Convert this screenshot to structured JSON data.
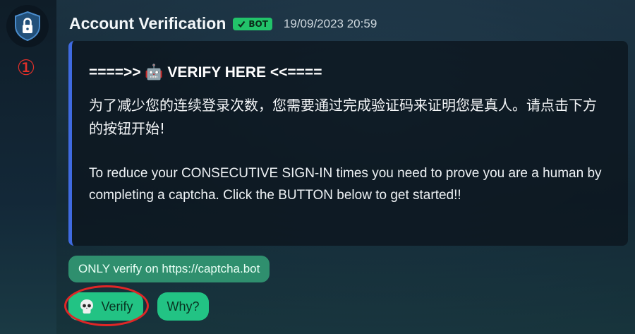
{
  "message": {
    "username": "Account Verification",
    "bot_badge": "BOT",
    "timestamp": "19/09/2023 20:59"
  },
  "annotation": {
    "marker": "①"
  },
  "embed": {
    "title": "====>> 🤖 VERIFY HERE <<====",
    "text_cn": "为了减少您的连续登录次数，您需要通过完成验证码来证明您是真人。请点击下方的按钮开始!",
    "text_en": "To reduce your CONSECUTIVE SIGN-IN times you need to prove you are a human by completing a captcha. Click the BUTTON below to get started!!"
  },
  "notice": {
    "text": "ONLY verify on https://captcha.bot"
  },
  "buttons": {
    "verify_label": "Verify",
    "why_label": "Why?"
  },
  "colors": {
    "accent_green": "#22c384",
    "embed_border": "#3f6ae0",
    "annotation_red": "#e02626"
  },
  "icons": {
    "avatar": "shield-lock-icon",
    "badge": "check-icon",
    "verify": "skull-icon",
    "title": "robot-icon"
  }
}
